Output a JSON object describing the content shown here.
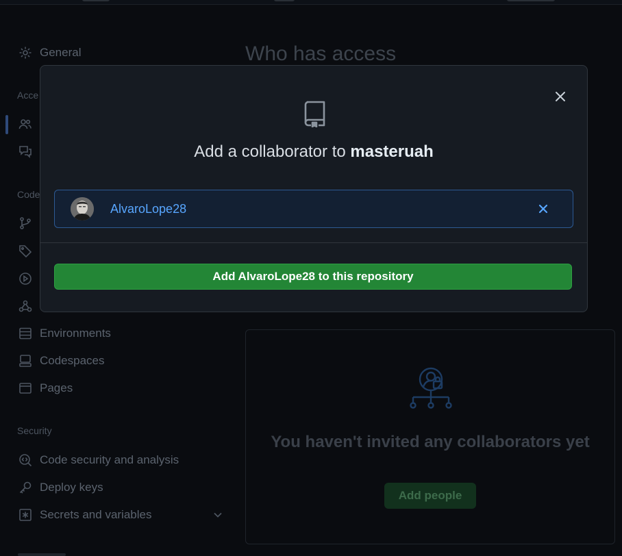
{
  "sidebar": {
    "general_label": "General",
    "access_heading": "Acce",
    "code_heading": "Code",
    "environments_label": "Environments",
    "codespaces_label": "Codespaces",
    "pages_label": "Pages",
    "security_heading": "Security",
    "code_security_label": "Code security and analysis",
    "deploy_keys_label": "Deploy keys",
    "secrets_label": "Secrets and variables"
  },
  "main": {
    "heading": "Who has access",
    "empty_title": "You haven't invited any collaborators yet",
    "add_people_label": "Add people"
  },
  "modal": {
    "title_prefix": "Add a collaborator to ",
    "repo_name": "masteruah",
    "selected_user": "AlvaroLope28",
    "add_button_label": "Add AlvaroLope28 to this repository"
  },
  "colors": {
    "accent_blue": "#58a6ff",
    "button_green": "#238636",
    "modal_bg": "#161b22"
  }
}
